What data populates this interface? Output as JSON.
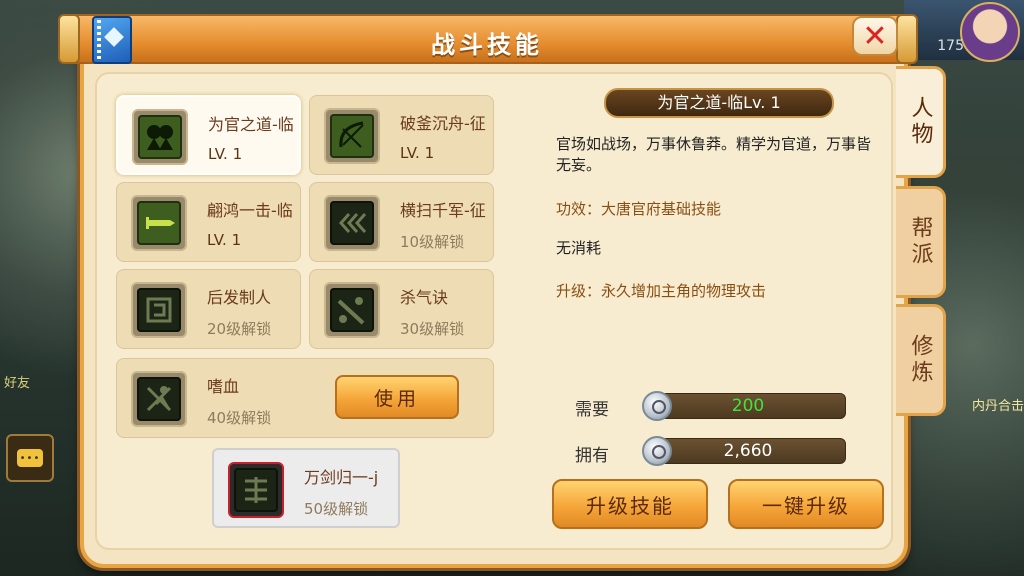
{
  "window": {
    "title": "战斗技能",
    "close_label": "✕"
  },
  "side_tabs": [
    {
      "label": "人物",
      "active": true
    },
    {
      "label": "帮派",
      "active": false
    },
    {
      "label": "修炼",
      "active": false
    }
  ],
  "skills": [
    {
      "name": "为官之道-临",
      "status": "LV. 1",
      "unlocked": true,
      "selected": true
    },
    {
      "name": "破釜沉舟-征",
      "status": "LV. 1",
      "unlocked": true,
      "selected": false
    },
    {
      "name": "翩鸿一击-临",
      "status": "LV. 1",
      "unlocked": true,
      "selected": false
    },
    {
      "name": "横扫千军-征",
      "status": "10级解锁",
      "unlocked": false,
      "selected": false
    },
    {
      "name": "后发制人",
      "status": "20级解锁",
      "unlocked": false,
      "selected": false
    },
    {
      "name": "杀气诀",
      "status": "30级解锁",
      "unlocked": false,
      "selected": false
    },
    {
      "name": "嗜血",
      "status": "40级解锁",
      "unlocked": false,
      "selected": false
    }
  ],
  "use_button": "使用",
  "special_skill": {
    "name": "万剑归一-j",
    "status": "50级解锁"
  },
  "detail": {
    "title": "为官之道-临Lv. 1",
    "description": "官场如战场，万事休鲁莽。精学为官道，万事皆无妄。",
    "effect": "功效：大唐官府基础技能",
    "cost": "无消耗",
    "upgrade": "升级：永久增加主角的物理攻击"
  },
  "resources": {
    "need_label": "需要",
    "need_value": "200",
    "have_label": "拥有",
    "have_value": "2,660"
  },
  "buttons": {
    "upgrade": "升级技能",
    "one_key_upgrade": "一键升级"
  },
  "background": {
    "level": "175",
    "left_text": "好友",
    "right_text": "内丹合击"
  },
  "colors": {
    "accent_orange": "#e58d2f",
    "panel_bg": "#f4e4c2",
    "need_green": "#43e33a"
  }
}
